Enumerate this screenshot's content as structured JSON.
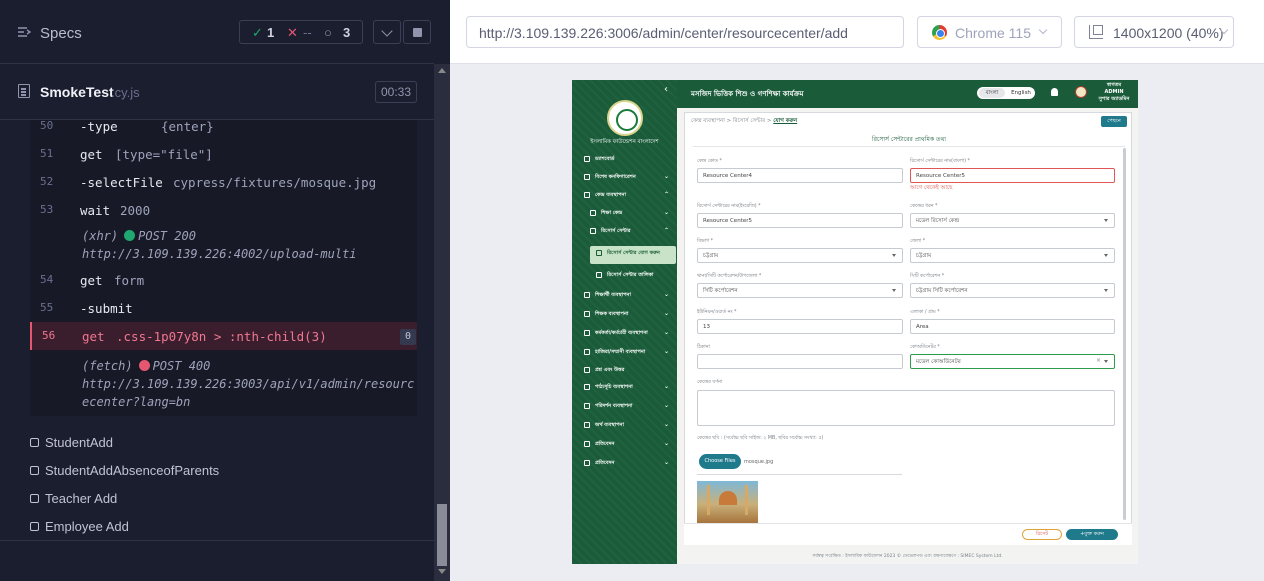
{
  "reporter": {
    "specs_label": "Specs",
    "stats": {
      "passed": "1",
      "failed": "--",
      "pending": "3"
    },
    "spec_file": {
      "name": "SmokeTest",
      "ext": ".cy.js",
      "duration": "00:33"
    },
    "commands": [
      {
        "num": "50",
        "name": "-type",
        "arg": "{enter}"
      },
      {
        "num": "51",
        "name": "get",
        "arg": "[type=\"file\"]"
      },
      {
        "num": "52",
        "name": "-selectFile",
        "arg": "cypress/fixtures/mosque.jpg"
      },
      {
        "num": "53",
        "name": "wait",
        "arg": "2000"
      },
      {
        "num": "54",
        "name": "get",
        "arg": "form"
      },
      {
        "num": "55",
        "name": "-submit",
        "arg": ""
      },
      {
        "num": "56",
        "name": "get",
        "arg": ".css-1p07y8n > :nth-child(3)",
        "count": "0"
      }
    ],
    "xhr": {
      "type": "(xhr)",
      "status": "POST 200",
      "url": "http://3.109.139.226:4002/upload-multi"
    },
    "fetch": {
      "type": "(fetch)",
      "status": "POST 400",
      "url_line1": "http://3.109.139.226:3003/api/v1/admin/resourc",
      "url_line2": "ecenter?lang=bn"
    },
    "tests": [
      "StudentAdd",
      "StudentAddAbsenceofParents",
      "Teacher Add",
      "Employee Add"
    ]
  },
  "aut_header": {
    "url": "http://3.109.139.226:3006/admin/center/resourcecenter/add",
    "browser": "Chrome 115",
    "viewport": "1400x1200  (40%)"
  },
  "app": {
    "topbar_title": "মসজিদ ভিত্তিক শিশু ও গণশিক্ষা কার্যক্রম",
    "lang": {
      "bn": "বাংলা",
      "en": "English"
    },
    "user": {
      "line1": "স্বাগতম",
      "line2": "ADMIN",
      "line3": "সুপার অ্যাডমিন"
    },
    "org_name": "ইসলামিক ফাউন্ডেশন বাংলাদেশ",
    "menu": [
      "ড্যাশবোর্ড",
      "বিশেষ কনফিগারেশন",
      "কেন্দ্র ব্যবস্থাপনা",
      "শিক্ষা কেন্দ্র",
      "রিসোর্স সেন্টার",
      "রিসোর্স সেন্টার যোগ করুন",
      "রিসোর্স সেন্টার তালিকা",
      "শিক্ষার্থী ব্যবস্থাপনা",
      "শিক্ষক ব্যবস্থাপনা",
      "কর্মকর্তা/কর্মচারী ব্যবস্থাপনা",
      "হাজিরা/সম্মানী ব্যবস্থাপনা",
      "প্রশ্ন এবং উত্তর",
      "পাঠ্যসূচি ব্যবস্থাপনা",
      "পরিদর্শন ব্যবস্থাপনা",
      "অর্থ ব্যবস্থাপনা",
      "প্রতিবেদন",
      "প্রতিবেদন"
    ],
    "breadcrumb": {
      "a": "কেন্দ্র ব্যবস্থাপনা",
      "b": "রিসোর্স সেন্টার",
      "c": "যোগ করুন"
    },
    "back_button": "পেছনে",
    "form_title": "রিসোর্স সেন্টারের প্রাথমিক তথ্য",
    "fields": {
      "center_code": {
        "label": "কেন্দ্র কোড *",
        "value": "Resource Center4"
      },
      "rc_name_bn": {
        "label": "রিসোর্স সেন্টারের নাম(বাংলা) *",
        "value": "Resource Center5",
        "error": "আগে থেকেই আছে"
      },
      "rc_name_en": {
        "label": "রিসোর্স সেন্টারের নাম(ইংরেজি) *",
        "value": "Resource Center5"
      },
      "center_type": {
        "label": "কেন্দ্রের ধরন *",
        "value": "মডেল রিসোর্স কেন্দ্র"
      },
      "division": {
        "label": "বিভাগ *",
        "value": "চট্টগ্রাম"
      },
      "district": {
        "label": "জেলা *",
        "value": "চট্টগ্রাম"
      },
      "upazila": {
        "label": "থানা/সিটি কর্পোরেশন/উপজেলা *",
        "value": "সিটি কর্পোরেশন"
      },
      "city_corp": {
        "label": "সিটি কর্পোরেশন *",
        "value": "চট্টগ্রাম সিটি কর্পোরেশন"
      },
      "union": {
        "label": "ইউনিয়ন/ওয়ার্ড নং *",
        "value": "13"
      },
      "area": {
        "label": "এলাকা / গ্রাম *",
        "value": "Area"
      },
      "address": {
        "label": "ঠিকানা",
        "value": ""
      },
      "coordinator": {
        "label": "কোঅর্ডিনেটর *",
        "value": "মডেল কোঅর্ডিনেটর"
      },
      "description": {
        "label": "কেন্দ্রের বর্ণনা"
      },
      "image": {
        "label": "কেন্দ্রের ছবি : (সর্বোচ্চ ছবি সাইজ: ২ MB, ছবির সর্বোচ্চ সংখ্যা: ৫)",
        "button": "Choose Files",
        "chosen": "mosque.jpg"
      }
    },
    "buttons": {
      "cancel": "রিসেট",
      "submit": "+যুক্ত করুন"
    },
    "footer": "সর্বস্বত্ব সংরক্ষিত : ইসলামিক ফাউন্ডেশন 2023 © ডেভেলপড এবং রক্ষণাবেক্ষণে : SIMEC System Ltd."
  }
}
